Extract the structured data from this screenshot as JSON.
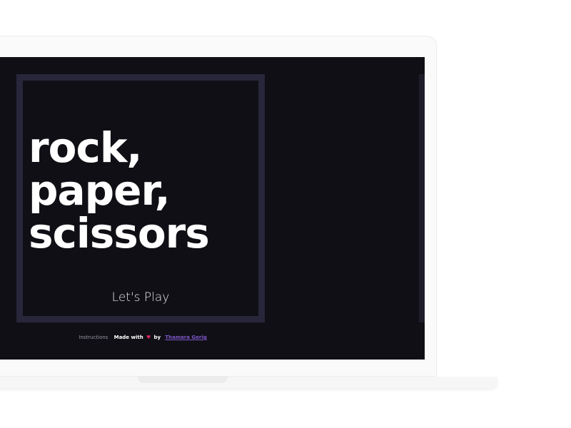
{
  "game": {
    "title_lines": [
      "rock,",
      "paper,",
      "scissors"
    ],
    "play_label": "Let's Play"
  },
  "footer": {
    "instructions_label": "Instructions",
    "made_with_label": "Made with",
    "heart_glyph": "♥",
    "by_label": "by",
    "author_label": "Thamara Gerig"
  },
  "colors": {
    "screen_background": "#100f15",
    "card_border": "#28263a",
    "heart": "#e0245e",
    "author_link": "#7d56c9"
  }
}
